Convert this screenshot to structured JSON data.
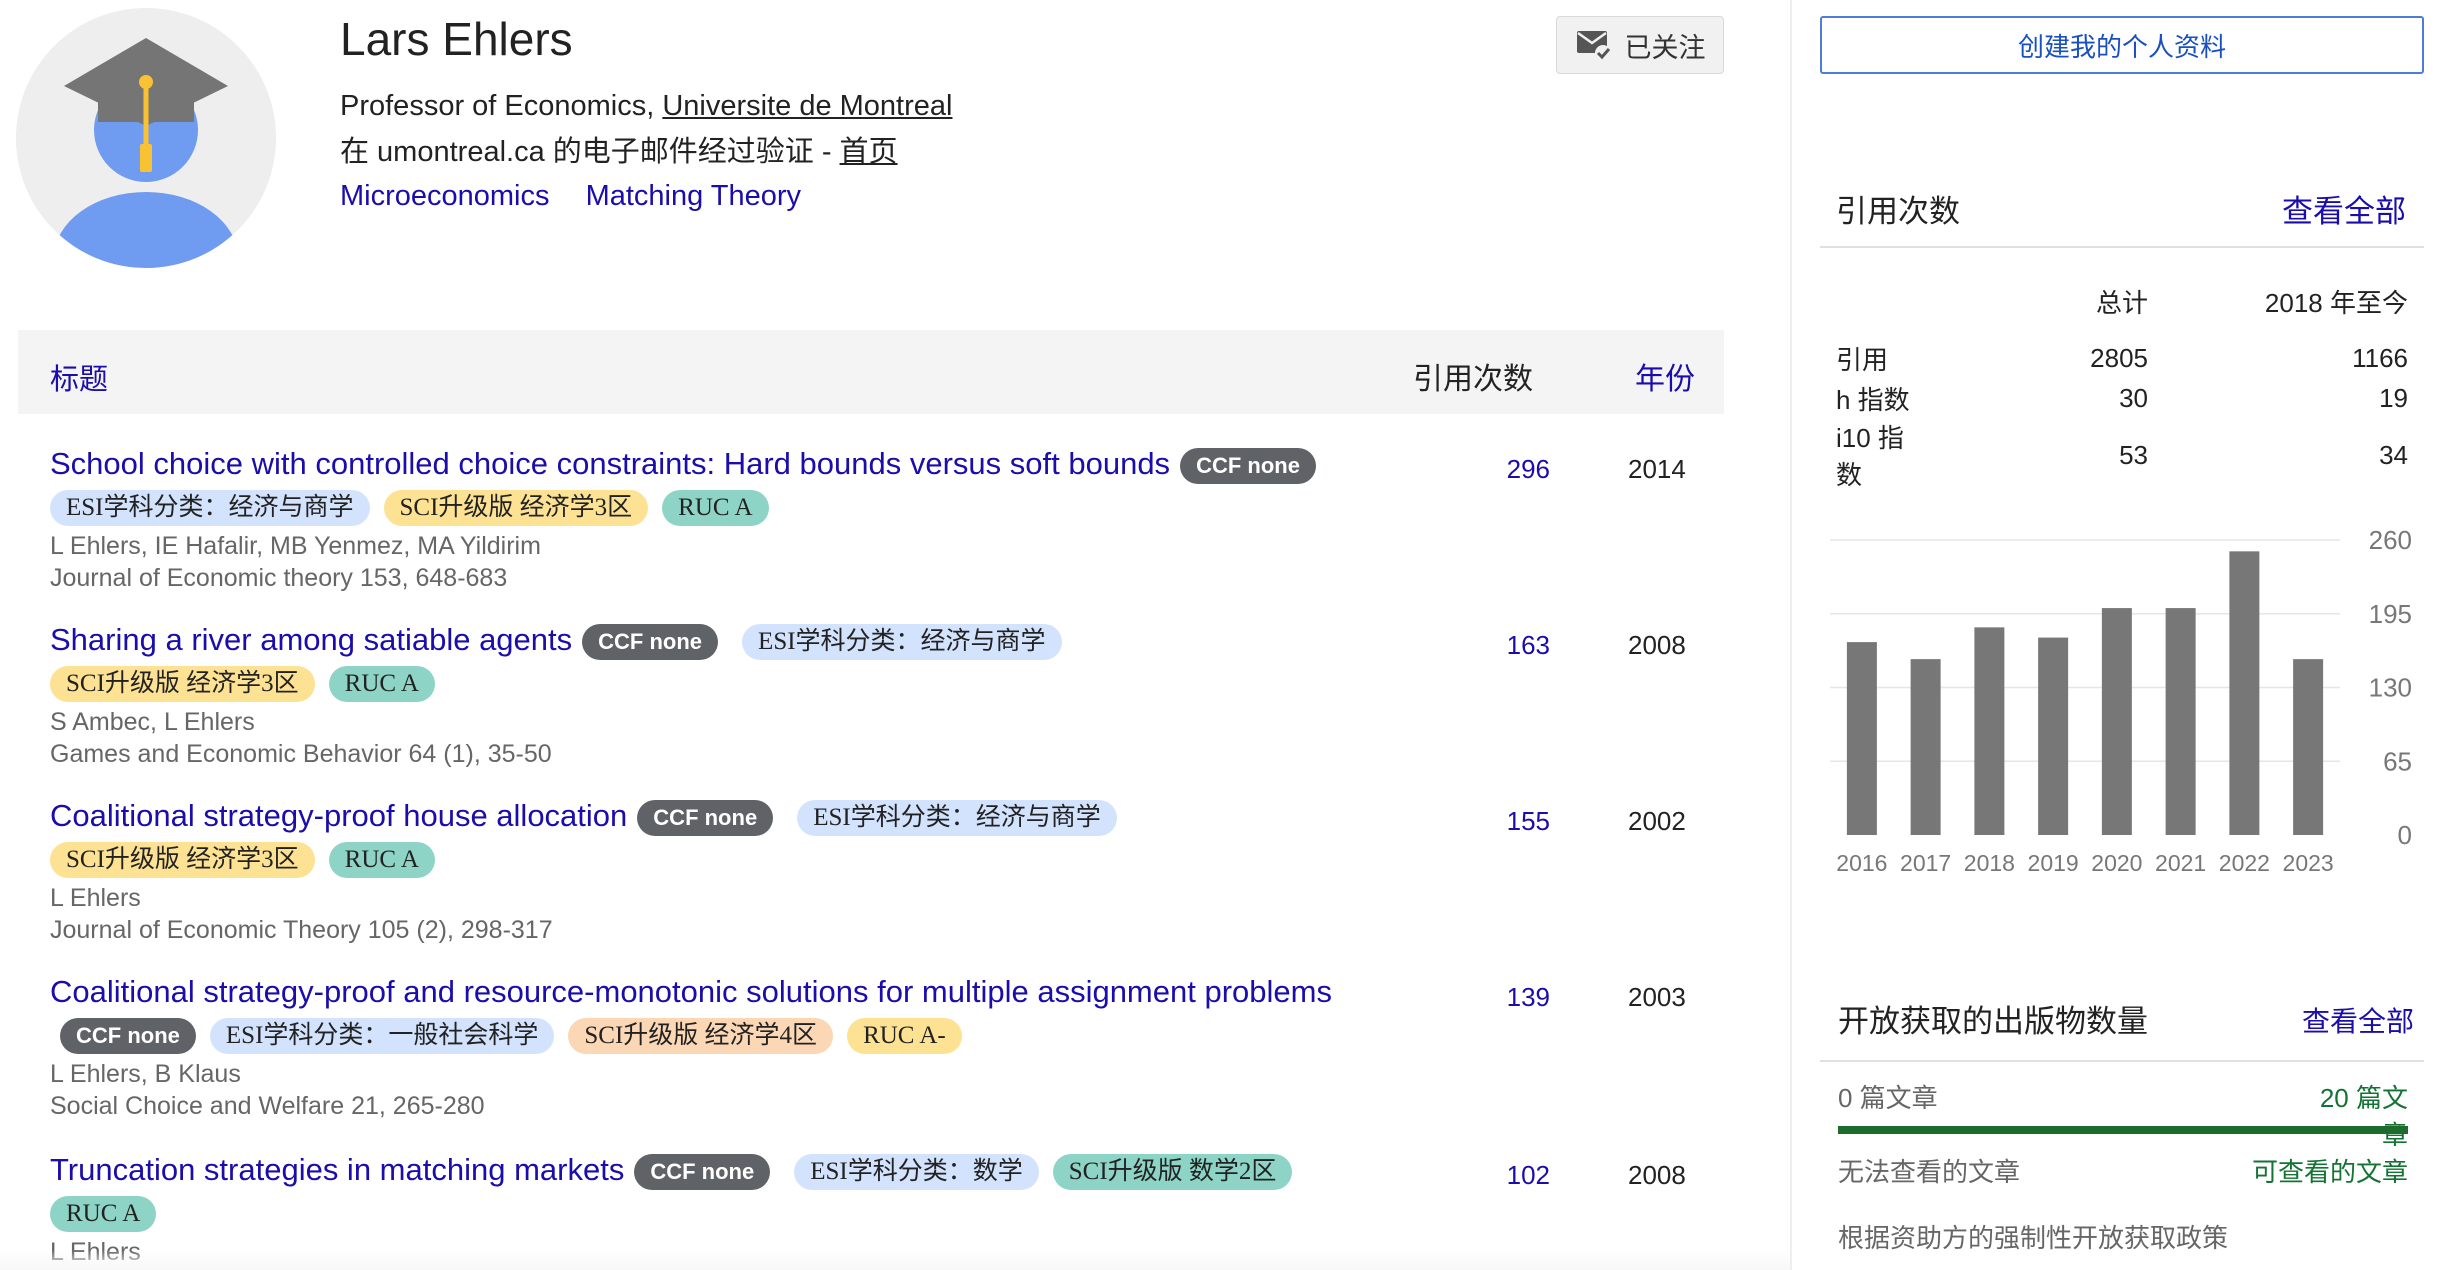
{
  "profile": {
    "name": "Lars Ehlers",
    "affiliation_prefix": "Professor of Economics, ",
    "affiliation_link": "Universite de Montreal",
    "verify_text": "在 umontreal.ca 的电子邮件经过验证 - ",
    "homepage_link": "首页",
    "interests": [
      "Microeconomics",
      "Matching Theory"
    ],
    "follow_label": "已关注"
  },
  "table": {
    "col_title": "标题",
    "col_cited": "引用次数",
    "col_year": "年份"
  },
  "publications": [
    {
      "title": "School choice with controlled choice constraints: Hard bounds versus soft bounds",
      "ccf": "CCF none",
      "tags": [
        {
          "text": "ESI学科分类：经济与商学",
          "kind": "esi"
        },
        {
          "text": "SCI升级版 经济学3区",
          "kind": "sci"
        },
        {
          "text": "RUC A",
          "kind": "ruc"
        }
      ],
      "authors": "L Ehlers, IE Hafalir, MB Yenmez, MA Yildirim",
      "venue": "Journal of Economic theory 153, 648-683",
      "cites": "296",
      "year": "2014"
    },
    {
      "title": "Sharing a river among satiable agents",
      "ccf": "CCF none",
      "tags": [
        {
          "text": "ESI学科分类：经济与商学",
          "kind": "esi"
        },
        {
          "text": "SCI升级版 经济学3区",
          "kind": "sci"
        },
        {
          "text": "RUC A",
          "kind": "ruc"
        }
      ],
      "authors": "S Ambec, L Ehlers",
      "venue": "Games and Economic Behavior 64 (1), 35-50",
      "cites": "163",
      "year": "2008"
    },
    {
      "title": "Coalitional strategy-proof house allocation",
      "ccf": "CCF none",
      "tags": [
        {
          "text": "ESI学科分类：经济与商学",
          "kind": "esi"
        },
        {
          "text": "SCI升级版 经济学3区",
          "kind": "sci"
        },
        {
          "text": "RUC A",
          "kind": "ruc"
        }
      ],
      "authors": "L Ehlers",
      "venue": "Journal of Economic Theory 105 (2), 298-317",
      "cites": "155",
      "year": "2002"
    },
    {
      "title": "Coalitional strategy-proof and resource-monotonic solutions for multiple assignment problems",
      "ccf": "CCF none",
      "tags": [
        {
          "text": "ESI学科分类：一般社会科学",
          "kind": "esi"
        },
        {
          "text": "SCI升级版 经济学4区",
          "kind": "sci4"
        },
        {
          "text": "RUC A-",
          "kind": "ruca"
        }
      ],
      "authors": "L Ehlers, B Klaus",
      "venue": "Social Choice and Welfare 21, 265-280",
      "cites": "139",
      "year": "2003"
    },
    {
      "title": "Truncation strategies in matching markets",
      "ccf": "CCF none",
      "tags": [
        {
          "text": "ESI学科分类：数学",
          "kind": "esi"
        },
        {
          "text": "SCI升级版 数学2区",
          "kind": "scim"
        },
        {
          "text": "RUC A",
          "kind": "ruc"
        }
      ],
      "authors": "L Ehlers",
      "venue": "",
      "cites": "102",
      "year": "2008"
    }
  ],
  "sidebar": {
    "create_profile": "创建我的个人资料",
    "citations_title": "引用次数",
    "view_all": "查看全部",
    "col_total": "总计",
    "col_since": "2018 年至今",
    "rows": [
      {
        "label": "引用",
        "total": "2805",
        "since": "1166"
      },
      {
        "label": "h 指数",
        "total": "30",
        "since": "19"
      },
      {
        "label": "i10 指数",
        "total": "53",
        "since": "34"
      }
    ],
    "oa_title": "开放获取的出版物数量",
    "oa_view_all": "查看全部",
    "oa_unavailable": "0 篇文章",
    "oa_available": "20 篇文章",
    "oa_unavailable_label": "无法查看的文章",
    "oa_available_label": "可查看的文章",
    "oa_policy": "根据资助方的强制性开放获取政策"
  },
  "chart_data": {
    "type": "bar",
    "categories": [
      "2016",
      "2017",
      "2018",
      "2019",
      "2020",
      "2021",
      "2022",
      "2023"
    ],
    "values": [
      170,
      155,
      183,
      174,
      200,
      200,
      250,
      155
    ],
    "ylim": [
      0,
      260
    ],
    "yticks": [
      0,
      65,
      130,
      195,
      260
    ],
    "grid": true,
    "bar_color": "#777777"
  }
}
